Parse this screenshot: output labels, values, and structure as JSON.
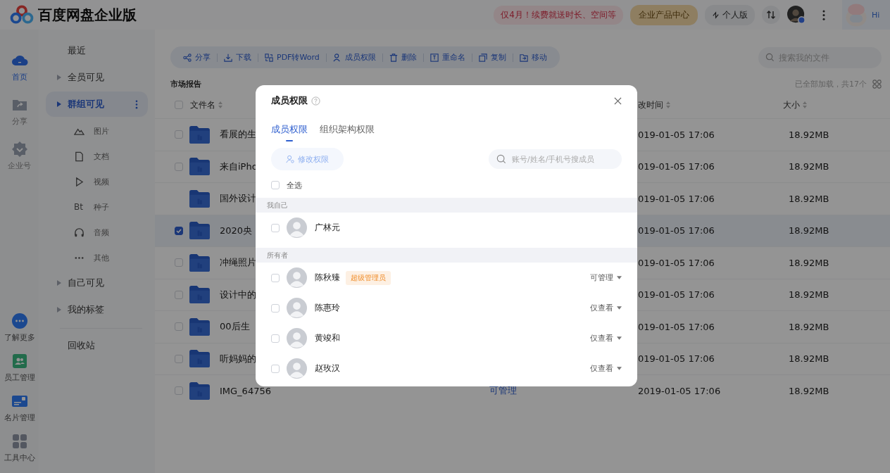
{
  "header": {
    "logo_text": "百度网盘企业版",
    "promo": "仅4月！续费就送时长、空间等",
    "product_center": "企业产品中心",
    "personal": "个人版",
    "hi": "Hi"
  },
  "rail": {
    "top": [
      {
        "label": "首页",
        "kind": "home",
        "selected": true
      },
      {
        "label": "分享",
        "kind": "share",
        "selected": false
      },
      {
        "label": "企业号",
        "kind": "badge",
        "selected": false
      }
    ],
    "bottom": [
      {
        "label": "了解更多",
        "kind": "more"
      },
      {
        "label": "员工管理",
        "kind": "staff"
      },
      {
        "label": "名片管理",
        "kind": "card"
      },
      {
        "label": "工具中心",
        "kind": "tools"
      }
    ]
  },
  "nav": [
    {
      "label": "最近",
      "kind": "plain",
      "selected": false
    },
    {
      "label": "全员可见",
      "kind": "group",
      "selected": false
    },
    {
      "label": "群组可见",
      "kind": "group",
      "selected": true,
      "children": [
        {
          "label": "图片",
          "kind": "image"
        },
        {
          "label": "文档",
          "kind": "doc"
        },
        {
          "label": "视频",
          "kind": "video"
        },
        {
          "label": "种子",
          "kind": "torrent",
          "glyph": "Bt"
        },
        {
          "label": "音频",
          "kind": "audio"
        },
        {
          "label": "其他",
          "kind": "other"
        }
      ]
    },
    {
      "label": "自己可见",
      "kind": "group",
      "selected": false
    },
    {
      "label": "我的标签",
      "kind": "group",
      "selected": false
    },
    {
      "label": "回收站",
      "kind": "plain",
      "selected": false
    }
  ],
  "toolbar": [
    {
      "label": "分享",
      "kind": "share"
    },
    {
      "label": "下载",
      "kind": "download"
    },
    {
      "label": "PDF转Word",
      "kind": "convert"
    },
    {
      "label": "成员权限",
      "kind": "member"
    },
    {
      "label": "删除",
      "kind": "delete"
    },
    {
      "label": "重命名",
      "kind": "rename"
    },
    {
      "label": "复制",
      "kind": "copy"
    },
    {
      "label": "移动",
      "kind": "move"
    }
  ],
  "search": {
    "placeholder": "搜索我的文件"
  },
  "breadcrumb": "市场报告",
  "load_status": "已全部加载，共17个",
  "table": {
    "columns": [
      "文件名",
      "改时间",
      "大小"
    ],
    "select_all_checked": false,
    "rows": [
      {
        "name": "看展的生",
        "modified": "019-01-05 17:06",
        "size": "18.92MB",
        "has_checkbox": true,
        "checked": false
      },
      {
        "name": "来自iPho",
        "modified": "019-01-05 17:06",
        "size": "18.92MB",
        "has_checkbox": true,
        "checked": false
      },
      {
        "name": "国外设计",
        "modified": "019-01-05 17:06",
        "size": "18.92MB",
        "has_checkbox": false
      },
      {
        "name": "2020央",
        "modified": "019-01-05 17:06",
        "size": "18.92MB",
        "has_checkbox": true,
        "checked": true
      },
      {
        "name": "冲绳照片",
        "modified": "019-01-05 17:06",
        "size": "18.92MB",
        "has_checkbox": true,
        "checked": false
      },
      {
        "name": "设计中的",
        "modified": "019-01-05 17:06",
        "size": "18.92MB",
        "has_checkbox": true,
        "checked": false
      },
      {
        "name": "00后生",
        "modified": "019-01-05 17:06",
        "size": "18.92MB",
        "has_checkbox": true,
        "checked": false
      },
      {
        "name": "听妈妈的",
        "modified": "019-01-05 17:06",
        "size": "18.92MB",
        "has_checkbox": true,
        "checked": false
      },
      {
        "name": "IMG_64756",
        "permission": "可管理",
        "modified": "2019-01-05 17:06",
        "size": "18.92MB",
        "has_checkbox": true,
        "checked": false
      }
    ]
  },
  "modal": {
    "title": "成员权限",
    "tabs": [
      {
        "label": "成员权限",
        "selected": true
      },
      {
        "label": "组织架构权限",
        "selected": false
      }
    ],
    "edit_button": {
      "label": "修改权限",
      "disabled": true
    },
    "search": {
      "placeholder": "账号/姓名/手机号搜成员"
    },
    "select_all": {
      "label": "全选",
      "checked": false
    },
    "sections": [
      {
        "title": "我自己",
        "members": [
          {
            "name": "广林元",
            "checked": false
          }
        ]
      },
      {
        "title": "所有者",
        "members": [
          {
            "name": "陈秋臻",
            "badge": "超级管理员",
            "role": "可管理",
            "checked": false
          },
          {
            "name": "陈惠玲",
            "role": "仅查看",
            "checked": false
          },
          {
            "name": "黄竣和",
            "role": "仅查看",
            "checked": false
          },
          {
            "name": "赵玫汉",
            "role": "仅查看",
            "checked": false
          }
        ]
      }
    ]
  }
}
